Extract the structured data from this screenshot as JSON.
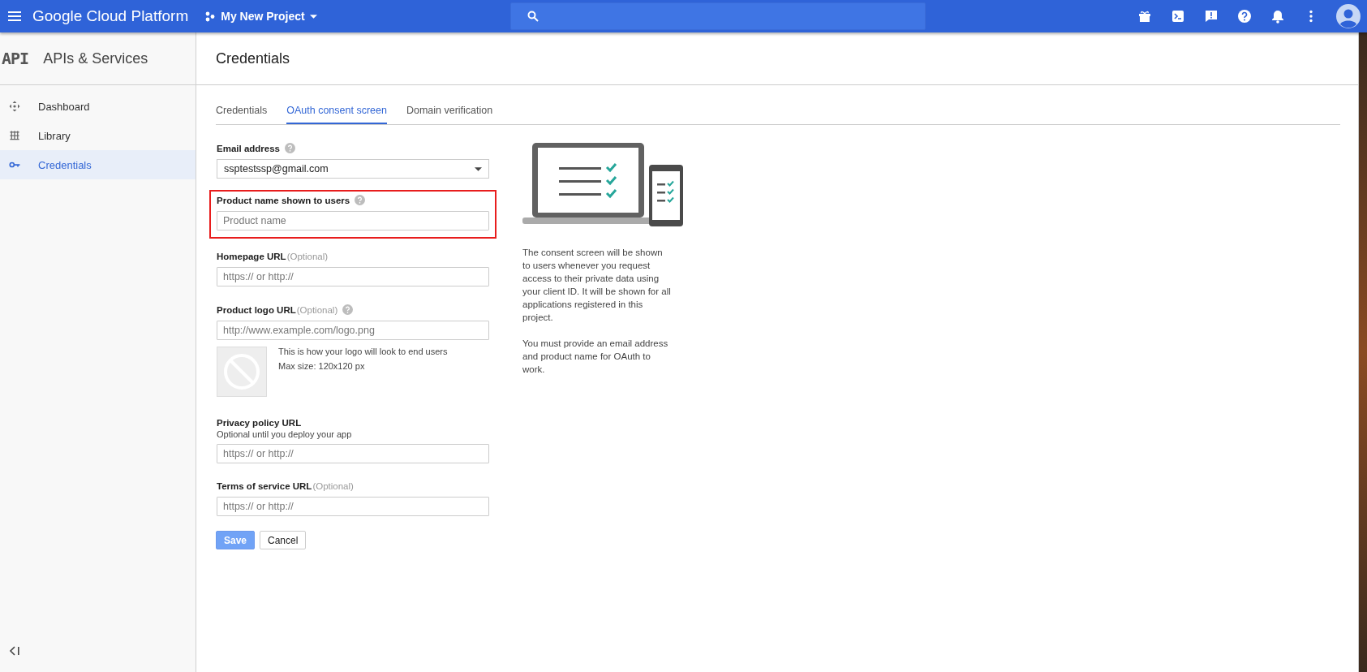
{
  "topbar": {
    "brand": "Google Cloud Platform",
    "project": "My New Project"
  },
  "sidebar": {
    "icon_text": "API",
    "title": "APIs & Services",
    "items": [
      {
        "label": "Dashboard",
        "selected": false
      },
      {
        "label": "Library",
        "selected": false
      },
      {
        "label": "Credentials",
        "selected": true
      }
    ]
  },
  "page": {
    "title": "Credentials"
  },
  "tabs": [
    {
      "label": "Credentials",
      "selected": false
    },
    {
      "label": "OAuth consent screen",
      "selected": true
    },
    {
      "label": "Domain verification",
      "selected": false
    }
  ],
  "fields": [
    {
      "kind": "select",
      "label": "Email address",
      "help": true,
      "value": "ssptestssp@gmail.com",
      "highlighted": false
    },
    {
      "kind": "text",
      "label": "Product name shown to users",
      "help": true,
      "placeholder": "Product name",
      "highlighted": true
    },
    {
      "kind": "text",
      "label": "Homepage URL",
      "note": "(Optional)",
      "help": false,
      "placeholder": "https:// or http://",
      "highlighted": false
    },
    {
      "kind": "text",
      "label": "Product logo URL",
      "note": "(Optional)",
      "help": true,
      "placeholder": "http://www.example.com/logo.png",
      "highlighted": false,
      "preview": [
        "This is how your logo will look to end users",
        "Max size: 120x120 px"
      ]
    },
    {
      "kind": "text",
      "label": "Privacy policy URL",
      "hint": "Optional until you deploy your app",
      "help": false,
      "placeholder": "https:// or http://",
      "highlighted": false
    },
    {
      "kind": "text",
      "label": "Terms of service URL",
      "note": "(Optional)",
      "help": false,
      "placeholder": "https:// or http://",
      "highlighted": false
    }
  ],
  "buttons": [
    {
      "label": "Save",
      "kind": "primary",
      "disabled": true
    },
    {
      "label": "Cancel",
      "kind": "secondary",
      "disabled": false
    }
  ],
  "info": [
    "The consent screen will be shown to users whenever you request access to their private data using your client ID. It will be shown for all applications registered in this project.",
    "You must provide an email address and product name for OAuth to work."
  ]
}
